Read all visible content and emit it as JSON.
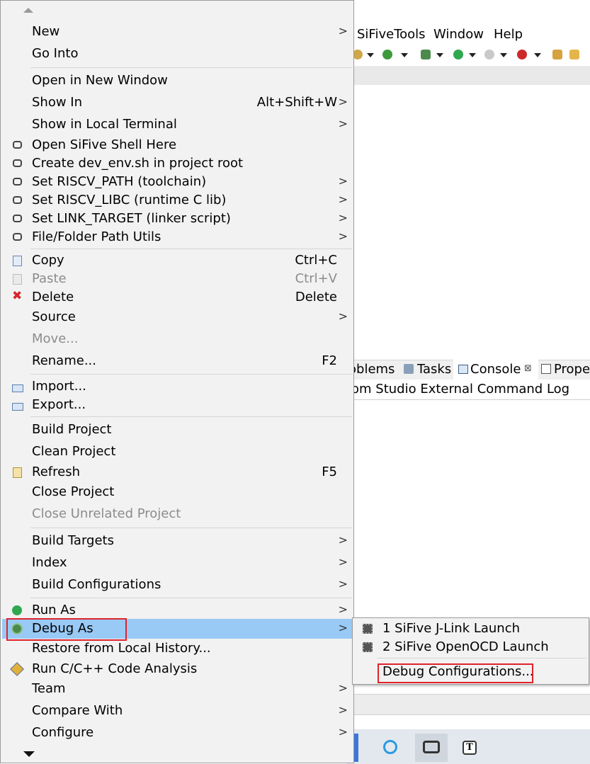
{
  "background": {
    "menubar": [
      "SiFiveTools",
      "Window",
      "Help"
    ],
    "views_tabs": [
      {
        "label": "oblems",
        "icon": "problems-icon"
      },
      {
        "label": "Tasks",
        "icon": "tasks-icon"
      },
      {
        "label": "Console",
        "icon": "console-icon",
        "close": "⊠"
      },
      {
        "label": "Prope",
        "icon": "properties-icon"
      }
    ],
    "console_title": "om Studio External Command Log"
  },
  "context_menu": {
    "items": [
      {
        "label": "New",
        "submenu": true
      },
      {
        "label": "Go Into"
      },
      {
        "label": "Open in New Window"
      },
      {
        "label": "Show In",
        "shortcut": "Alt+Shift+W",
        "submenu": true
      },
      {
        "label": "Show in Local Terminal",
        "submenu": true
      },
      {
        "label": "Open SiFive Shell Here",
        "icon": "sifive-icon"
      },
      {
        "label": "Create dev_env.sh in project root",
        "icon": "sifive-icon"
      },
      {
        "label": "Set RISCV_PATH (toolchain)",
        "icon": "sifive-icon",
        "submenu": true
      },
      {
        "label": "Set RISCV_LIBC (runtime C lib)",
        "icon": "sifive-icon",
        "submenu": true
      },
      {
        "label": "Set LINK_TARGET (linker script)",
        "icon": "sifive-icon",
        "submenu": true
      },
      {
        "label": "File/Folder Path Utils",
        "icon": "sifive-icon",
        "submenu": true
      },
      {
        "label": "Copy",
        "shortcut": "Ctrl+C",
        "icon": "copy-icon"
      },
      {
        "label": "Paste",
        "shortcut": "Ctrl+V",
        "icon": "paste-icon",
        "disabled": true
      },
      {
        "label": "Delete",
        "shortcut": "Delete",
        "icon": "delete-icon"
      },
      {
        "label": "Source",
        "submenu": true
      },
      {
        "label": "Move...",
        "disabled": true
      },
      {
        "label": "Rename...",
        "shortcut": "F2"
      },
      {
        "label": "Import...",
        "icon": "import-icon"
      },
      {
        "label": "Export...",
        "icon": "export-icon"
      },
      {
        "label": "Build Project"
      },
      {
        "label": "Clean Project"
      },
      {
        "label": "Refresh",
        "shortcut": "F5",
        "icon": "refresh-icon"
      },
      {
        "label": "Close Project"
      },
      {
        "label": "Close Unrelated Project",
        "disabled": true
      },
      {
        "label": "Build Targets",
        "submenu": true
      },
      {
        "label": "Index",
        "submenu": true
      },
      {
        "label": "Build Configurations",
        "submenu": true
      },
      {
        "label": "Run As",
        "icon": "run-icon",
        "submenu": true
      },
      {
        "label": "Debug As",
        "icon": "debug-icon",
        "submenu": true,
        "selected": true
      },
      {
        "label": "Restore from Local History..."
      },
      {
        "label": "Run C/C++ Code Analysis",
        "icon": "code-analysis-icon"
      },
      {
        "label": "Team",
        "submenu": true
      },
      {
        "label": "Compare With",
        "submenu": true
      },
      {
        "label": "Configure",
        "submenu": true
      }
    ]
  },
  "debug_submenu": {
    "items": [
      {
        "label": "1 SiFive J-Link Launch",
        "icon": "chip-icon"
      },
      {
        "label": "2 SiFive OpenOCD Launch",
        "icon": "chip-icon"
      },
      {
        "label": "Debug Configurations..."
      }
    ]
  },
  "colors": {
    "menu_bg": "#f2f2f2",
    "selection": "#99c9f5",
    "highlight_box": "#e0232b"
  }
}
